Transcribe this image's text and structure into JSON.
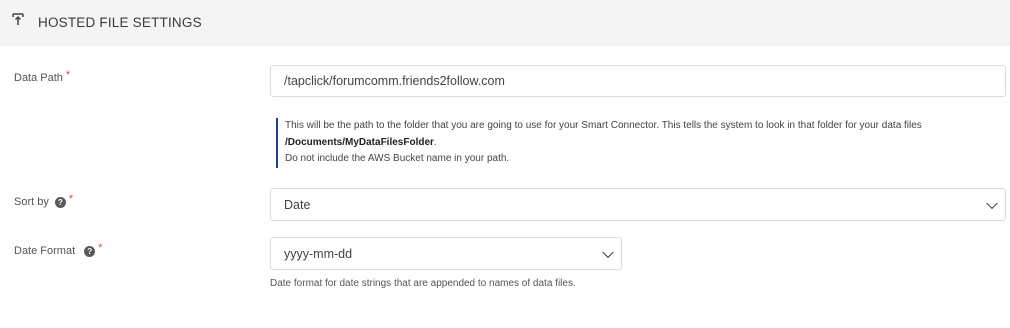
{
  "header": {
    "title": "HOSTED FILE SETTINGS",
    "icon": "upload-icon"
  },
  "data_path": {
    "label": "Data Path",
    "required_mark": "*",
    "value": "/tapclick/forumcomm.friends2follow.com",
    "help": {
      "line1": "This will be the path to the folder that you are going to use for your Smart Connector. This tells the system to look in that folder for your data files",
      "line2_bold": "/Documents/MyDataFilesFolder",
      "line2_tail": ".",
      "line3": "Do not include the AWS Bucket name in your path."
    }
  },
  "sort_by": {
    "label": "Sort by",
    "required_mark": "*",
    "help_icon": "question-icon",
    "value": "Date"
  },
  "date_format": {
    "label": "Date Format",
    "required_mark": "*",
    "help_icon": "question-icon",
    "value": "yyyy-mm-dd",
    "hint": "Date format for date strings that are appended to names of data files."
  },
  "colors": {
    "accent": "#1f3f8f",
    "required": "#e0473b",
    "header_bg": "#f4f4f4"
  }
}
